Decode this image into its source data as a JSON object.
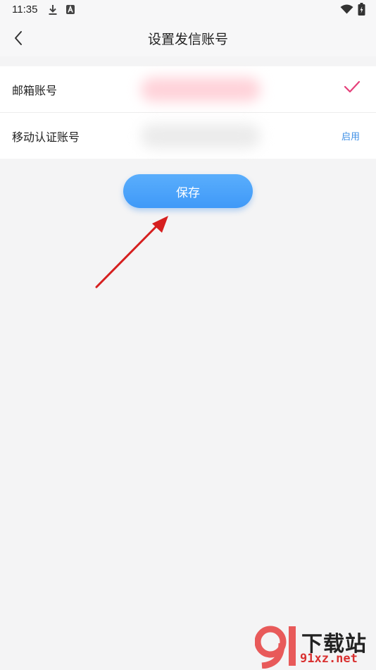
{
  "status_bar": {
    "time": "11:35",
    "icons": [
      "download-icon",
      "a-notification-icon",
      "wifi-icon",
      "battery-charging-icon"
    ]
  },
  "header": {
    "title": "设置发信账号",
    "back_icon": "chevron-left-icon"
  },
  "rows": [
    {
      "label": "邮箱账号",
      "value_blurred": true,
      "status_icon": "checkmark-icon"
    },
    {
      "label": "移动认证账号",
      "value_blurred": true,
      "action": "启用"
    }
  ],
  "save_button": {
    "label": "保存"
  },
  "colors": {
    "accent_blue": "#4aa3fa",
    "check_pink": "#e5407a",
    "link_blue": "#3f8fe6",
    "arrow_red": "#d61f1f",
    "background": "#f4f4f5"
  },
  "watermark": {
    "logo_text": "91",
    "top_text": "下载站",
    "bottom_text": "91xz.net"
  }
}
